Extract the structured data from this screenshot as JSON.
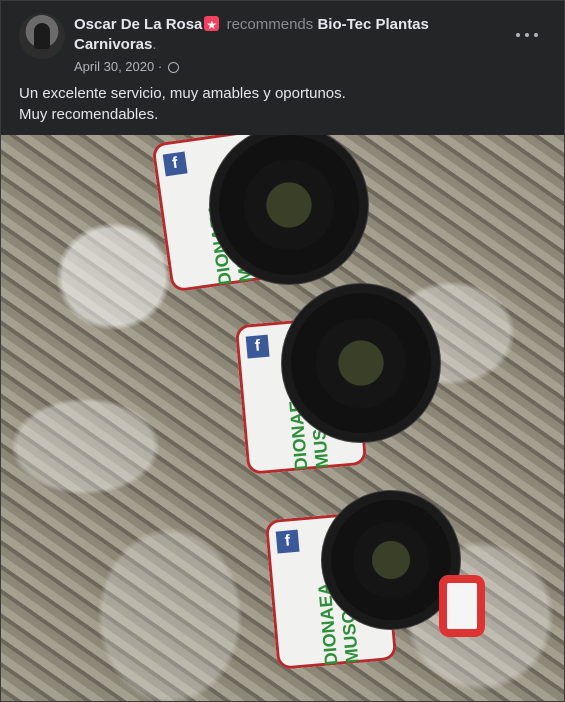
{
  "post": {
    "author": "Oscar De La Rosa",
    "action": "recommends",
    "page": "Bio-Tec Plantas Carnivoras",
    "date": "April 30, 2020",
    "text_line1": "Un excelente servicio, muy amables y oportunos.",
    "text_line2": "Muy recomendables."
  },
  "photo": {
    "label_text": "DIONAEA MUSCIPULA",
    "fb_icon": "f"
  },
  "icons": {
    "more": "more-options-icon",
    "globe": "globe-icon",
    "badge": "recommend-badge-icon"
  }
}
